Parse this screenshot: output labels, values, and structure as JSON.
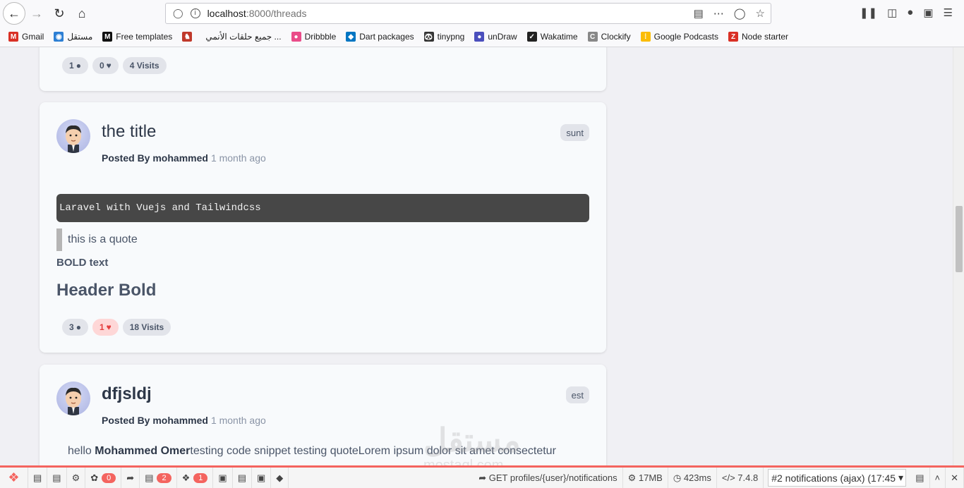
{
  "browser": {
    "url_host": "localhost",
    "url_path": ":8000/threads"
  },
  "bookmarks": [
    {
      "label": "Gmail",
      "icon": "gmail-icon",
      "color": "#d93025",
      "glyph": "M"
    },
    {
      "label": "مستقل",
      "icon": "mostaql-icon",
      "color": "#2d7fd4",
      "glyph": "◉"
    },
    {
      "label": "Free templates",
      "icon": "templates-icon",
      "color": "#111111",
      "glyph": "M"
    },
    {
      "label": "",
      "icon": "anime-icon",
      "color": "#c0392b",
      "glyph": "♞"
    },
    {
      "label": "جميع حلقات الأنمي ...",
      "icon": "",
      "color": "",
      "glyph": ""
    },
    {
      "label": "Dribbble",
      "icon": "dribbble-icon",
      "color": "#ea4c89",
      "glyph": "●"
    },
    {
      "label": "Dart packages",
      "icon": "dart-icon",
      "color": "#0175c2",
      "glyph": "◆"
    },
    {
      "label": "tinypng",
      "icon": "tinypng-icon",
      "color": "#333333",
      "glyph": "🐼"
    },
    {
      "label": "unDraw",
      "icon": "undraw-icon",
      "color": "#4b4fbd",
      "glyph": "●"
    },
    {
      "label": "Wakatime",
      "icon": "wakatime-icon",
      "color": "#222222",
      "glyph": "✓"
    },
    {
      "label": "Clockify",
      "icon": "clockify-icon",
      "color": "#888888",
      "glyph": "C"
    },
    {
      "label": "Google Podcasts",
      "icon": "podcasts-icon",
      "color": "#fbbc04",
      "glyph": "⁞"
    },
    {
      "label": "Node starter",
      "icon": "node-starter-icon",
      "color": "#d93025",
      "glyph": "Z"
    }
  ],
  "threads": [
    {
      "stats": {
        "comments": "1",
        "likes": "0",
        "visits": "4 Visits"
      }
    },
    {
      "title": "the title",
      "posted_by": "Posted By mohammed",
      "time": "1 month ago",
      "tag": "sunt",
      "code": "Laravel with Vuejs and Tailwindcss",
      "quote": "this is a quote",
      "bold_text": "BOLD text",
      "header_bold": "Header Bold",
      "stats": {
        "comments": "3",
        "likes": "1",
        "visits": "18 Visits"
      }
    },
    {
      "title": "dfjsldj",
      "posted_by": "Posted By mohammed",
      "time": "1 month ago",
      "tag": "est",
      "body_prefix": "hello ",
      "body_bold": "Mohammed Omer",
      "body_rest": "testing code snippet testing quoteLorem ipsum dolor sit amet consectetur"
    }
  ],
  "watermark": {
    "arabic": "مستقل",
    "latin": "mostaql.com"
  },
  "debugbar": {
    "badges": {
      "messages": "0",
      "queries": "2",
      "models": "1"
    },
    "request": "GET profiles/{user}/notifications",
    "memory": "17MB",
    "time": "423ms",
    "php": "7.4.8",
    "dataset": "#2 notifications (ajax) (17:45"
  }
}
